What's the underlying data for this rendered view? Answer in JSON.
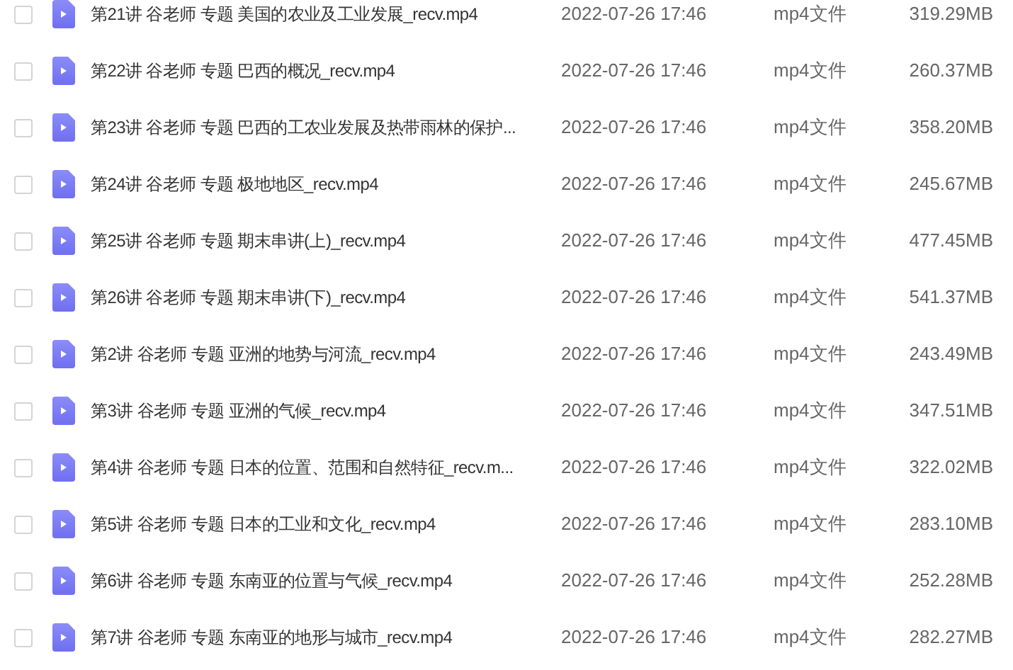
{
  "files": [
    {
      "name": "第21讲 谷老师 专题 美国的农业及工业发展_recv.mp4",
      "date": "2022-07-26 17:46",
      "type": "mp4文件",
      "size": "319.29MB",
      "checked": false
    },
    {
      "name": "第22讲 谷老师 专题 巴西的概况_recv.mp4",
      "date": "2022-07-26 17:46",
      "type": "mp4文件",
      "size": "260.37MB",
      "checked": false
    },
    {
      "name": "第23讲 谷老师 专题 巴西的工农业发展及热带雨林的保护...",
      "date": "2022-07-26 17:46",
      "type": "mp4文件",
      "size": "358.20MB",
      "checked": false
    },
    {
      "name": "第24讲 谷老师 专题 极地地区_recv.mp4",
      "date": "2022-07-26 17:46",
      "type": "mp4文件",
      "size": "245.67MB",
      "checked": false
    },
    {
      "name": "第25讲 谷老师 专题 期末串讲(上)_recv.mp4",
      "date": "2022-07-26 17:46",
      "type": "mp4文件",
      "size": "477.45MB",
      "checked": false
    },
    {
      "name": "第26讲 谷老师 专题 期末串讲(下)_recv.mp4",
      "date": "2022-07-26 17:46",
      "type": "mp4文件",
      "size": "541.37MB",
      "checked": false
    },
    {
      "name": "第2讲 谷老师 专题 亚洲的地势与河流_recv.mp4",
      "date": "2022-07-26 17:46",
      "type": "mp4文件",
      "size": "243.49MB",
      "checked": false
    },
    {
      "name": "第3讲 谷老师 专题 亚洲的气候_recv.mp4",
      "date": "2022-07-26 17:46",
      "type": "mp4文件",
      "size": "347.51MB",
      "checked": false
    },
    {
      "name": "第4讲 谷老师 专题 日本的位置、范围和自然特征_recv.m...",
      "date": "2022-07-26 17:46",
      "type": "mp4文件",
      "size": "322.02MB",
      "checked": false
    },
    {
      "name": "第5讲 谷老师 专题 日本的工业和文化_recv.mp4",
      "date": "2022-07-26 17:46",
      "type": "mp4文件",
      "size": "283.10MB",
      "checked": false
    },
    {
      "name": "第6讲 谷老师 专题 东南亚的位置与气候_recv.mp4",
      "date": "2022-07-26 17:46",
      "type": "mp4文件",
      "size": "252.28MB",
      "checked": false
    },
    {
      "name": "第7讲 谷老师 专题 东南亚的地形与城市_recv.mp4",
      "date": "2022-07-26 17:46",
      "type": "mp4文件",
      "size": "282.27MB",
      "checked": false
    }
  ]
}
